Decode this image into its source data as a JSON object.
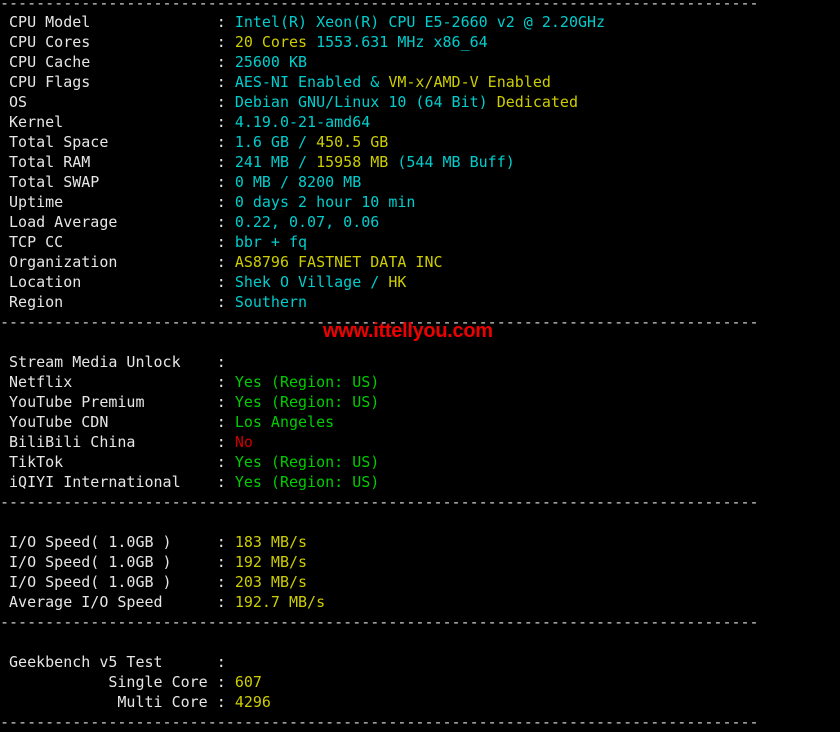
{
  "terminal": {
    "separator": "------------------------------------------------------------------------------------",
    "colon": " : ",
    "label_width": 22
  },
  "watermark": {
    "text": "www.ittellyou.com",
    "color": "#ee0000"
  },
  "colors": {
    "background": "#000000",
    "label": "#e6e6e6",
    "cyan": "#00cdcd",
    "yellow": "#cdcd00",
    "green": "#00cd00",
    "red": "#cd0000"
  },
  "sections": [
    {
      "name": "system-info",
      "rows": [
        {
          "label": "CPU Model",
          "parts": [
            {
              "text": "Intel(R) Xeon(R) CPU E5-2660 v2 @ 2.20GHz",
              "color": "cyan"
            }
          ]
        },
        {
          "label": "CPU Cores",
          "parts": [
            {
              "text": "20 Cores ",
              "color": "yellow"
            },
            {
              "text": "1553.631 MHz x86_64",
              "color": "cyan"
            }
          ]
        },
        {
          "label": "CPU Cache",
          "parts": [
            {
              "text": "25600 KB",
              "color": "cyan"
            }
          ]
        },
        {
          "label": "CPU Flags",
          "parts": [
            {
              "text": "AES-NI Enabled",
              "color": "cyan"
            },
            {
              "text": " & ",
              "color": "cyan"
            },
            {
              "text": "VM-x/AMD-V Enabled",
              "color": "yellow"
            }
          ]
        },
        {
          "label": "OS",
          "parts": [
            {
              "text": "Debian GNU/Linux 10 (64 Bit) ",
              "color": "cyan"
            },
            {
              "text": "Dedicated",
              "color": "yellow"
            }
          ]
        },
        {
          "label": "Kernel",
          "parts": [
            {
              "text": "4.19.0-21-amd64",
              "color": "cyan"
            }
          ]
        },
        {
          "label": "Total Space",
          "parts": [
            {
              "text": "1.6 GB ",
              "color": "cyan"
            },
            {
              "text": "/ ",
              "color": "cyan"
            },
            {
              "text": "450.5 GB",
              "color": "yellow"
            }
          ]
        },
        {
          "label": "Total RAM",
          "parts": [
            {
              "text": "241 MB ",
              "color": "cyan"
            },
            {
              "text": "/ ",
              "color": "cyan"
            },
            {
              "text": "15958 MB ",
              "color": "yellow"
            },
            {
              "text": "(544 MB Buff)",
              "color": "cyan"
            }
          ]
        },
        {
          "label": "Total SWAP",
          "parts": [
            {
              "text": "0 MB / 8200 MB",
              "color": "cyan"
            }
          ]
        },
        {
          "label": "Uptime",
          "parts": [
            {
              "text": "0 days 2 hour 10 min",
              "color": "cyan"
            }
          ]
        },
        {
          "label": "Load Average",
          "parts": [
            {
              "text": "0.22, 0.07, 0.06",
              "color": "cyan"
            }
          ]
        },
        {
          "label": "TCP CC",
          "parts": [
            {
              "text": "bbr + fq",
              "color": "cyan"
            }
          ]
        },
        {
          "label": "Organization",
          "parts": [
            {
              "text": "AS8796 FASTNET DATA INC",
              "color": "yellow"
            }
          ]
        },
        {
          "label": "Location",
          "parts": [
            {
              "text": "Shek O Village / ",
              "color": "cyan"
            },
            {
              "text": "HK",
              "color": "yellow"
            }
          ]
        },
        {
          "label": "Region",
          "parts": [
            {
              "text": "Southern",
              "color": "cyan"
            }
          ]
        }
      ]
    },
    {
      "name": "stream-media-unlock",
      "rows": [
        {
          "label": "Stream Media Unlock",
          "parts": []
        },
        {
          "label": "Netflix",
          "parts": [
            {
              "text": "Yes (Region: US)",
              "color": "green"
            }
          ]
        },
        {
          "label": "YouTube Premium",
          "parts": [
            {
              "text": "Yes (Region: US)",
              "color": "green"
            }
          ]
        },
        {
          "label": "YouTube CDN",
          "parts": [
            {
              "text": "Los Angeles",
              "color": "green"
            }
          ]
        },
        {
          "label": "BiliBili China",
          "parts": [
            {
              "text": "No",
              "color": "red"
            }
          ]
        },
        {
          "label": "TikTok",
          "parts": [
            {
              "text": "Yes (Region: US)",
              "color": "green"
            }
          ]
        },
        {
          "label": "iQIYI International",
          "parts": [
            {
              "text": "Yes (Region: US)",
              "color": "green"
            }
          ]
        }
      ]
    },
    {
      "name": "io-speed",
      "rows": [
        {
          "label": "I/O Speed( 1.0GB )",
          "parts": [
            {
              "text": "183 MB/s",
              "color": "yellow"
            }
          ]
        },
        {
          "label": "I/O Speed( 1.0GB )",
          "parts": [
            {
              "text": "192 MB/s",
              "color": "yellow"
            }
          ]
        },
        {
          "label": "I/O Speed( 1.0GB )",
          "parts": [
            {
              "text": "203 MB/s",
              "color": "yellow"
            }
          ]
        },
        {
          "label": "Average I/O Speed",
          "parts": [
            {
              "text": "192.7 MB/s",
              "color": "yellow"
            }
          ]
        }
      ]
    },
    {
      "name": "geekbench",
      "rows": [
        {
          "label": "Geekbench v5 Test",
          "parts": []
        },
        {
          "label": "Single Core",
          "indent": "right",
          "parts": [
            {
              "text": "607",
              "color": "yellow"
            }
          ]
        },
        {
          "label": "Multi Core",
          "indent": "right",
          "parts": [
            {
              "text": "4296",
              "color": "yellow"
            }
          ]
        }
      ]
    }
  ]
}
